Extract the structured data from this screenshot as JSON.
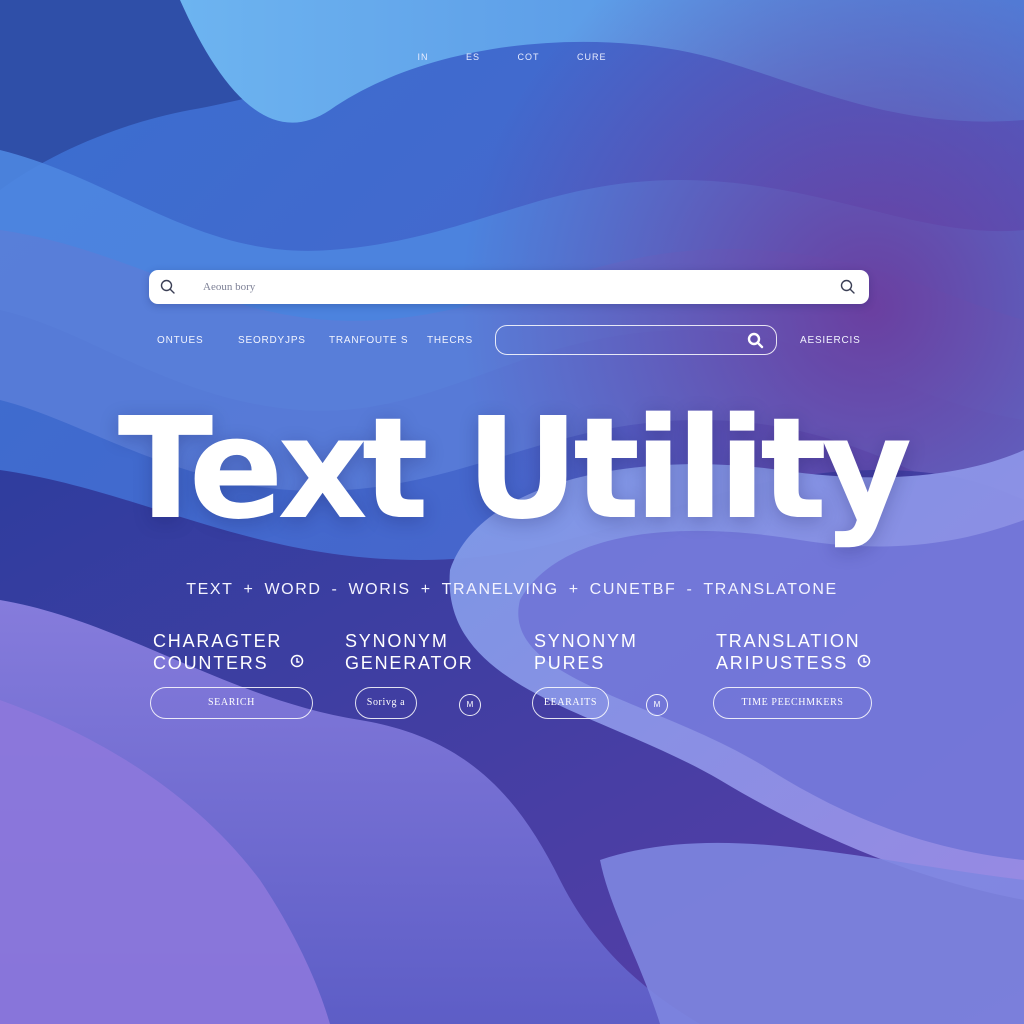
{
  "colors": {
    "background_light": "#6fb3ee",
    "background_blue": "#3f63c8",
    "background_violet": "#6a4fb8",
    "background_deep": "#2b2f86",
    "text": "#ffffff",
    "search_bg": "#ffffff"
  },
  "top_nav": [
    "IN",
    "ES",
    "COT",
    "CURE"
  ],
  "search": {
    "placeholder": "Aeoun bory",
    "icons": [
      "search-icon",
      "search-icon"
    ]
  },
  "secondary_nav": {
    "links": [
      "ONTUES",
      "SEORDYJPS",
      "TRANFOUTE S",
      "THECRS"
    ],
    "right_link": "AESIERCIS",
    "search_icon": "search-icon"
  },
  "hero": {
    "title": "Text Utility"
  },
  "feature_strip": [
    {
      "label": "TEXT",
      "sep": "+"
    },
    {
      "label": "WORD",
      "sep": "-"
    },
    {
      "label": "WORIS",
      "sep": "+"
    },
    {
      "label": "TRANELVING",
      "sep": "+"
    },
    {
      "label": "CUNETBF",
      "sep": "-"
    },
    {
      "label": "TRANSLATONE",
      "sep": ""
    }
  ],
  "tools": [
    {
      "title": [
        "CHARAGTER",
        "COUNTERS"
      ],
      "icon": "circle-arrow-icon"
    },
    {
      "title": [
        "SYNONYM",
        "GENERATOR"
      ],
      "icon": ""
    },
    {
      "title": [
        "SYNONYM",
        "PURES"
      ],
      "icon": ""
    },
    {
      "title": [
        "TRANSLATION",
        "ARIPUSTESS"
      ],
      "icon": "circle-arrow-icon"
    }
  ],
  "buttons": {
    "search": "SEARICH",
    "sort": "Sorivg a",
    "round_1": "M",
    "results": "EEARAITS",
    "round_2": "M",
    "time": "TIME PEECHMKERS"
  }
}
